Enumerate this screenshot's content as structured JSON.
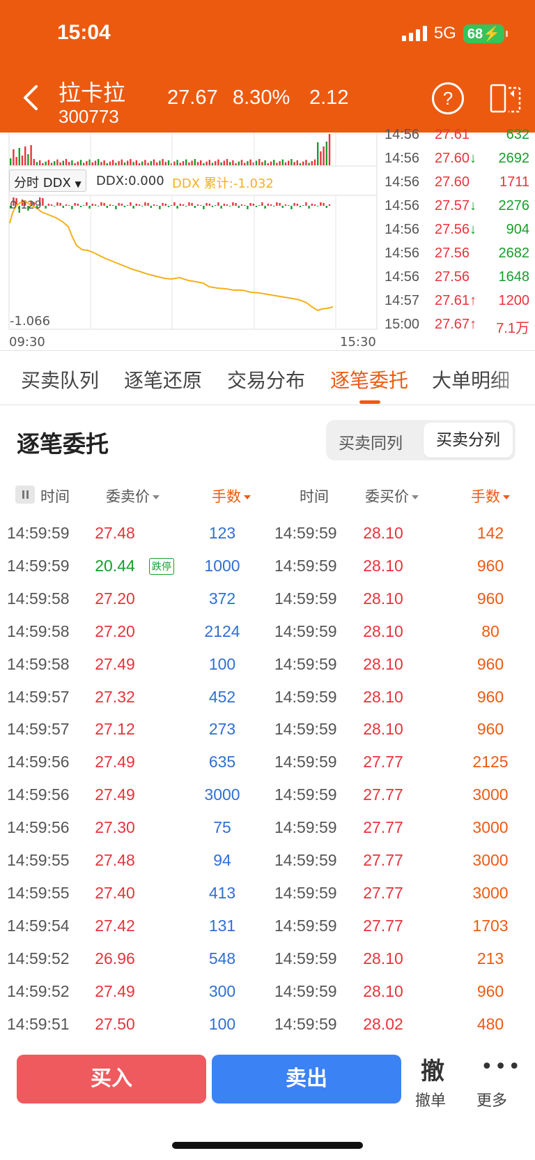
{
  "status_bar": {
    "time": "15:04",
    "network": "5G",
    "battery": "68"
  },
  "header": {
    "stock_name": "拉卡拉",
    "stock_code": "300773",
    "price": "27.67",
    "change_pct": "8.30%",
    "change": "2.12",
    "help_icon_label": "?"
  },
  "chart": {
    "indicator_select": "分时 DDX",
    "ddx_value": "DDX:0.000",
    "ddx_cumulative": "DDX 累计:-1.032",
    "top_label": "0.129",
    "bottom_label": "-1.066",
    "time_start": "09:30",
    "time_end": "15:30",
    "colors": {
      "line": "#f5b019",
      "up": "#e8333c",
      "down": "#169d2b"
    }
  },
  "ticks": [
    {
      "time": "14:56",
      "price": "27.61",
      "arrow": "",
      "vol": "632",
      "price_color": "red",
      "vol_color": "green"
    },
    {
      "time": "14:56",
      "price": "27.60",
      "arrow": "↓",
      "vol": "2692",
      "price_color": "red",
      "vol_color": "green"
    },
    {
      "time": "14:56",
      "price": "27.60",
      "arrow": "",
      "vol": "1711",
      "price_color": "red",
      "vol_color": "red"
    },
    {
      "time": "14:56",
      "price": "27.57",
      "arrow": "↓",
      "vol": "2276",
      "price_color": "red",
      "vol_color": "green"
    },
    {
      "time": "14:56",
      "price": "27.56",
      "arrow": "↓",
      "vol": "904",
      "price_color": "red",
      "vol_color": "green"
    },
    {
      "time": "14:56",
      "price": "27.56",
      "arrow": "",
      "vol": "2682",
      "price_color": "red",
      "vol_color": "green"
    },
    {
      "time": "14:56",
      "price": "27.56",
      "arrow": "",
      "vol": "1648",
      "price_color": "red",
      "vol_color": "green"
    },
    {
      "time": "14:57",
      "price": "27.61",
      "arrow": "↑",
      "vol": "1200",
      "price_color": "red",
      "vol_color": "red"
    },
    {
      "time": "15:00",
      "price": "27.67",
      "arrow": "↑",
      "vol": "7.1万",
      "price_color": "red",
      "vol_color": "red"
    }
  ],
  "tabs": [
    "买卖队列",
    "逐笔还原",
    "交易分布",
    "逐笔委托",
    "大单明细"
  ],
  "active_tab": "逐笔委托",
  "section": {
    "title": "逐笔委托",
    "segment_option_a": "买卖同列",
    "segment_option_b": "买卖分列"
  },
  "columns": {
    "sell_time": "时间",
    "sell_price": "委卖价",
    "sell_volume": "手数",
    "buy_time": "时间",
    "buy_price": "委买价",
    "buy_volume": "手数"
  },
  "orders": [
    {
      "sell_time": "14:59:59",
      "sell_price": "27.48",
      "sell_color": "red",
      "badge": "",
      "sell_volume": "123",
      "buy_time": "14:59:59",
      "buy_price": "28.10",
      "buy_volume": "142"
    },
    {
      "sell_time": "14:59:59",
      "sell_price": "20.44",
      "sell_color": "green",
      "badge": "跌停",
      "sell_volume": "1000",
      "buy_time": "14:59:59",
      "buy_price": "28.10",
      "buy_volume": "960"
    },
    {
      "sell_time": "14:59:58",
      "sell_price": "27.20",
      "sell_color": "red",
      "badge": "",
      "sell_volume": "372",
      "buy_time": "14:59:59",
      "buy_price": "28.10",
      "buy_volume": "960"
    },
    {
      "sell_time": "14:59:58",
      "sell_price": "27.20",
      "sell_color": "red",
      "badge": "",
      "sell_volume": "2124",
      "buy_time": "14:59:59",
      "buy_price": "28.10",
      "buy_volume": "80"
    },
    {
      "sell_time": "14:59:58",
      "sell_price": "27.49",
      "sell_color": "red",
      "badge": "",
      "sell_volume": "100",
      "buy_time": "14:59:59",
      "buy_price": "28.10",
      "buy_volume": "960"
    },
    {
      "sell_time": "14:59:57",
      "sell_price": "27.32",
      "sell_color": "red",
      "badge": "",
      "sell_volume": "452",
      "buy_time": "14:59:59",
      "buy_price": "28.10",
      "buy_volume": "960"
    },
    {
      "sell_time": "14:59:57",
      "sell_price": "27.12",
      "sell_color": "red",
      "badge": "",
      "sell_volume": "273",
      "buy_time": "14:59:59",
      "buy_price": "28.10",
      "buy_volume": "960"
    },
    {
      "sell_time": "14:59:56",
      "sell_price": "27.49",
      "sell_color": "red",
      "badge": "",
      "sell_volume": "635",
      "buy_time": "14:59:59",
      "buy_price": "27.77",
      "buy_volume": "2125"
    },
    {
      "sell_time": "14:59:56",
      "sell_price": "27.49",
      "sell_color": "red",
      "badge": "",
      "sell_volume": "3000",
      "buy_time": "14:59:59",
      "buy_price": "27.77",
      "buy_volume": "3000"
    },
    {
      "sell_time": "14:59:56",
      "sell_price": "27.30",
      "sell_color": "red",
      "badge": "",
      "sell_volume": "75",
      "buy_time": "14:59:59",
      "buy_price": "27.77",
      "buy_volume": "3000"
    },
    {
      "sell_time": "14:59:55",
      "sell_price": "27.48",
      "sell_color": "red",
      "badge": "",
      "sell_volume": "94",
      "buy_time": "14:59:59",
      "buy_price": "27.77",
      "buy_volume": "3000"
    },
    {
      "sell_time": "14:59:55",
      "sell_price": "27.40",
      "sell_color": "red",
      "badge": "",
      "sell_volume": "413",
      "buy_time": "14:59:59",
      "buy_price": "27.77",
      "buy_volume": "3000"
    },
    {
      "sell_time": "14:59:54",
      "sell_price": "27.42",
      "sell_color": "red",
      "badge": "",
      "sell_volume": "131",
      "buy_time": "14:59:59",
      "buy_price": "27.77",
      "buy_volume": "1703"
    },
    {
      "sell_time": "14:59:52",
      "sell_price": "26.96",
      "sell_color": "red",
      "badge": "",
      "sell_volume": "548",
      "buy_time": "14:59:59",
      "buy_price": "28.10",
      "buy_volume": "213"
    },
    {
      "sell_time": "14:59:52",
      "sell_price": "27.49",
      "sell_color": "red",
      "badge": "",
      "sell_volume": "300",
      "buy_time": "14:59:59",
      "buy_price": "28.10",
      "buy_volume": "960"
    },
    {
      "sell_time": "14:59:51",
      "sell_price": "27.50",
      "sell_color": "red",
      "badge": "",
      "sell_volume": "100",
      "buy_time": "14:59:59",
      "buy_price": "28.02",
      "buy_volume": "480"
    }
  ],
  "bottom_bar": {
    "buy_label": "买入",
    "sell_label": "卖出",
    "cancel_icon": "撤",
    "cancel_label": "撤单",
    "more_icon": "•••",
    "more_label": "更多"
  }
}
